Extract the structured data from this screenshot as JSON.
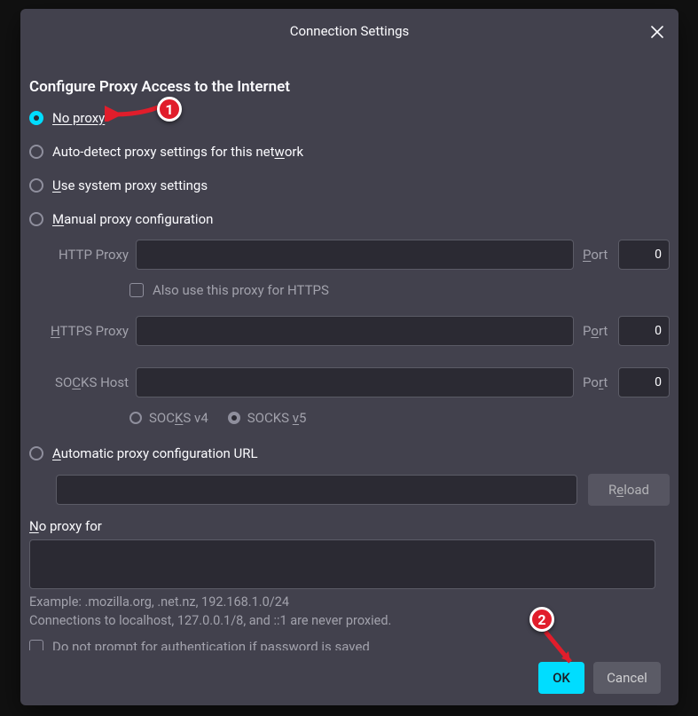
{
  "dialog": {
    "title": "Connection Settings",
    "section_title": "Configure Proxy Access to the Internet",
    "radios": {
      "no_proxy": "No proxy",
      "auto_detect_pre": "Auto-detect proxy settings for this net",
      "auto_detect_uline": "w",
      "auto_detect_post": "ork",
      "use_system_uline": "U",
      "use_system_post": "se system proxy settings",
      "manual_uline": "M",
      "manual_post": "anual proxy configuration",
      "auto_url_uline": "A",
      "auto_url_post": "utomatic proxy configuration URL"
    },
    "fields": {
      "http_label": "HTTP Proxy",
      "http_value": "",
      "http_port_label": "Port",
      "http_port_value": "0",
      "also_https": "Also use this proxy for HTTPS",
      "https_uline": "H",
      "https_post": "TTPS Proxy",
      "https_value": "",
      "https_port_label": "Port",
      "https_port_value": "0",
      "socks_pre": "SO",
      "socks_uline": "C",
      "socks_post": "KS Host",
      "socks_value": "",
      "socks_port_label": "Port",
      "socks_port_value": "0",
      "socks_v4_pre": "SOC",
      "socks_v4_uline": "K",
      "socks_v4_post": "S v4",
      "socks_v5_pre": "SOCKS ",
      "socks_v5_uline": "v",
      "socks_v5_post": "5",
      "auto_url_value": "",
      "reload_pre": "R",
      "reload_uline": "e",
      "reload_post": "load"
    },
    "noproxy": {
      "label_uline": "N",
      "label_post": "o proxy for",
      "value": "",
      "example": "Example: .mozilla.org, .net.nz, 192.168.1.0/24",
      "localhost_note": "Connections to localhost, 127.0.0.1/8, and ::1 are never proxied."
    },
    "auth_check_pre": "Do not prompt for authenti",
    "auth_check_uline": "c",
    "auth_check_post": "ation if password is saved",
    "buttons": {
      "ok": "OK",
      "cancel": "Cancel"
    }
  },
  "annotations": {
    "step1": "1",
    "step2": "2"
  },
  "colors": {
    "accent": "#00ddff",
    "callout": "#e11d2b"
  }
}
